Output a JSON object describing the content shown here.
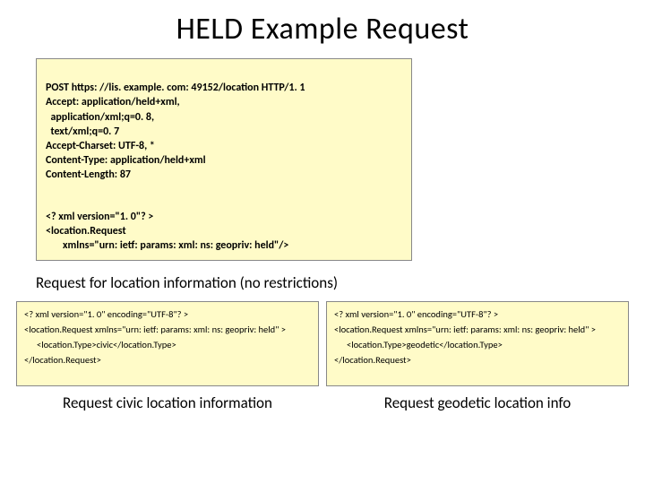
{
  "title": "HELD Example Request",
  "mainBox": {
    "line1": "POST https: //lis. example. com: 49152/location HTTP/1. 1",
    "line2a": "Accept:",
    "line2b": " application/held+xml,",
    "line3": "application/xml;q=0. 8,",
    "line4": "text/xml;q=0. 7",
    "line5a": "Accept-Charset:",
    "line5b": " UTF-8, *",
    "line6a": "Content-Type:",
    "line6b": " application/held+xml",
    "line7a": "Content-Length:",
    "line7b": " 87",
    "xml1": "<? xml version=\"1. 0\"? >",
    "xml2": "<location.Request",
    "xml3": "xmlns=\"urn: ietf: params: xml: ns: geopriv: held\"/>"
  },
  "mainCaption": "Request for location information (no restrictions)",
  "left": {
    "l1": "<? xml version=\"1. 0\" encoding=\"UTF-8\"? >",
    "l2": "<location.Request xmlns=\"urn: ietf: params: xml: ns: geopriv: held\" >",
    "l3": "<location.Type>civic</location.Type>",
    "l4": "</location.Request>",
    "caption": "Request civic location information"
  },
  "right": {
    "l1": "<? xml version=\"1. 0\" encoding=\"UTF-8\"? >",
    "l2": "<location.Request xmlns=\"urn: ietf: params: xml: ns: geopriv: held\" >",
    "l3": "<location.Type>geodetic</location.Type>",
    "l4": "</location.Request>",
    "caption": "Request geodetic location info"
  }
}
